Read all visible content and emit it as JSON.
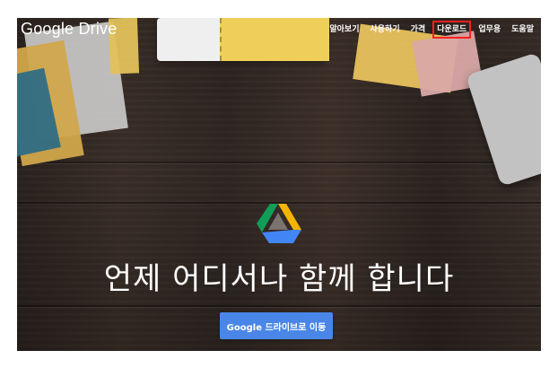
{
  "header": {
    "logo": "Google Drive",
    "nav": [
      {
        "label": "알아보기"
      },
      {
        "label": "사용하기"
      },
      {
        "label": "가격"
      },
      {
        "label": "다운로드",
        "active": true
      },
      {
        "label": "업무용"
      },
      {
        "label": "도움말"
      }
    ]
  },
  "hero": {
    "headline": "언제 어디서나 함께 합니다",
    "cta_label": "Google 드라이브로 이동",
    "logo_icon": "google-drive-logo-icon"
  },
  "colors": {
    "cta": "#4a86e8",
    "highlight": "#ff1f1f",
    "drive_green": "#0f9d58",
    "drive_yellow": "#f4b400",
    "drive_blue": "#4285f4"
  }
}
